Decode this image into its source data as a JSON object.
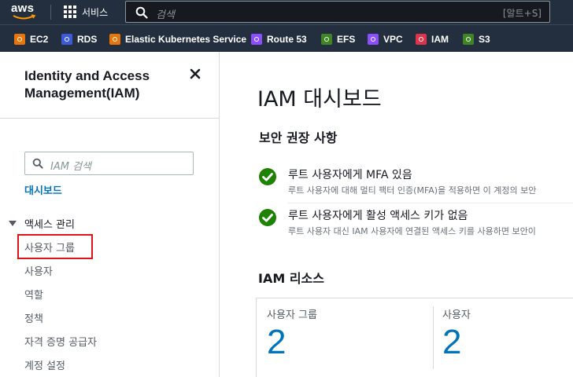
{
  "topnav": {
    "logo_text": "aws",
    "services_label": "서비스",
    "search_placeholder": "검색",
    "search_shortcut": "[알트+S]"
  },
  "favorites": [
    {
      "label": "EC2",
      "icon": "ec2-icon",
      "color": "#e7750b"
    },
    {
      "label": "RDS",
      "icon": "rds-icon",
      "color": "#3d5bd9"
    },
    {
      "label": "Elastic Kubernetes Service",
      "icon": "eks-icon",
      "color": "#e7750b"
    },
    {
      "label": "Route 53",
      "icon": "route53-icon",
      "color": "#8c4fff"
    },
    {
      "label": "EFS",
      "icon": "efs-icon",
      "color": "#3e8624"
    },
    {
      "label": "VPC",
      "icon": "vpc-icon",
      "color": "#8c4fff"
    },
    {
      "label": "IAM",
      "icon": "iam-icon",
      "color": "#dd344c"
    },
    {
      "label": "S3",
      "icon": "s3-icon",
      "color": "#3e8624"
    }
  ],
  "sidebar": {
    "title": "Identity and Access Management(IAM)",
    "search_placeholder": "IAM 검색",
    "dashboard": "대시보드",
    "section_label": "액세스 관리",
    "items": [
      {
        "label": "사용자 그룹"
      },
      {
        "label": "사용자"
      },
      {
        "label": "역할"
      },
      {
        "label": "정책"
      },
      {
        "label": "자격 증명 공급자"
      },
      {
        "label": "계정 설정"
      }
    ]
  },
  "main": {
    "page_title": "IAM 대시보드",
    "security_title": "보안 권장 사항",
    "recommendations": [
      {
        "title": "루트 사용자에게 MFA 있음",
        "desc": "루트 사용자에 대해 멀티 팩터 인증(MFA)을 적용하면 이 계정의 보안"
      },
      {
        "title": "루트 사용자에게 활성 액세스 키가 없음",
        "desc": "루트 사용자 대신 IAM 사용자에 연결된 액세스 키를 사용하면 보안이"
      }
    ],
    "resources_title": "IAM 리소스",
    "resources": [
      {
        "label": "사용자 그룹",
        "value": "2"
      },
      {
        "label": "사용자",
        "value": "2"
      }
    ]
  },
  "colors": {
    "nav_bg": "#232f3e",
    "link": "#0073bb",
    "success": "#1d8102",
    "highlight": "#e0131b"
  }
}
